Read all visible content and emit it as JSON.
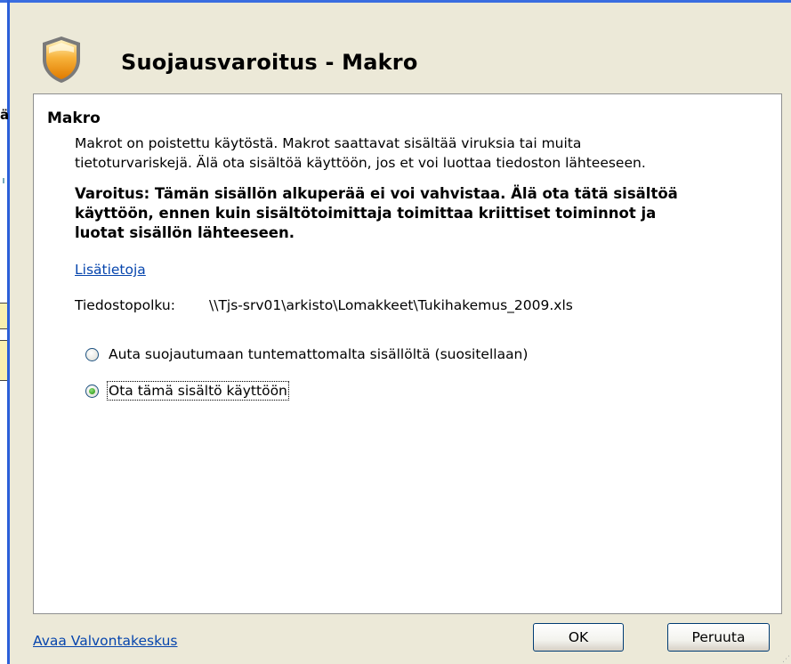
{
  "background_window": {
    "partial_char": "ä"
  },
  "dialog": {
    "title": "Suojausvaroitus - Makro",
    "icon": "shield-warning-icon",
    "section_heading": "Makro",
    "description_line1": "Makrot on poistettu käytöstä. Makrot saattavat sisältää viruksia tai muita",
    "description_line2": "tietoturvariskejä. Älä ota sisältöä käyttöön, jos et voi luottaa tiedoston lähteeseen.",
    "warning_line1": "Varoitus: Tämän sisällön alkuperää ei voi vahvistaa. Älä ota tätä sisältöä",
    "warning_line2": "käyttöön, ennen kuin sisältötoimittaja toimittaa kriittiset toiminnot ja",
    "warning_line3": "luotat sisällön lähteeseen.",
    "more_info_link": "Lisätietoja",
    "file_path_label": "Tiedostopolku:",
    "file_path_value": "\\\\Tjs-srv01\\arkisto\\Lomakkeet\\Tukihakemus_2009.xls",
    "options": [
      {
        "label": "Auta suojautumaan tuntemattomalta sisällöltä (suositellaan)",
        "selected": false
      },
      {
        "label": "Ota tämä sisältö käyttöön",
        "selected": true
      }
    ],
    "trust_center_link": "Avaa Valvontakeskus",
    "ok_button": "OK",
    "cancel_button": "Peruuta"
  },
  "colors": {
    "dialog_background": "#ece9d8",
    "link": "#0645ad",
    "radio_checked": "#3fa62a",
    "shield_orange": "#f5a623"
  }
}
